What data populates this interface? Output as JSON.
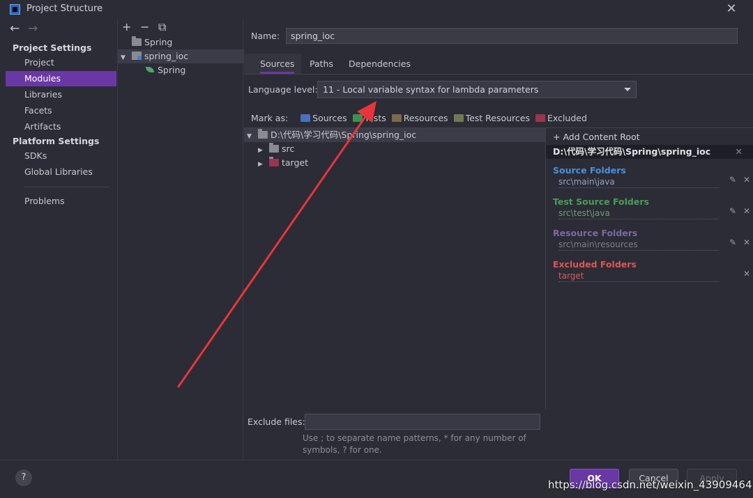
{
  "window": {
    "title": "Project Structure",
    "close_glyph": "✕"
  },
  "nav": {
    "back": "←",
    "forward": "→",
    "project_settings_header": "Project Settings",
    "platform_settings_header": "Platform Settings",
    "project_items": [
      "Project",
      "Modules",
      "Libraries",
      "Facets",
      "Artifacts"
    ],
    "platform_items": [
      "SDKs",
      "Global Libraries"
    ],
    "problems": "Problems",
    "selected": "Modules"
  },
  "module_tree": {
    "tools": [
      "+",
      "−",
      "⧉"
    ],
    "items": [
      {
        "label": "Spring",
        "kind": "folder"
      },
      {
        "label": "spring_ioc",
        "kind": "module",
        "expanded": true
      },
      {
        "label": "Spring",
        "kind": "facet"
      }
    ]
  },
  "module": {
    "name_label": "Name:",
    "name_value": "spring_ioc",
    "tabs": [
      "Sources",
      "Paths",
      "Dependencies"
    ],
    "active_tab": "Sources",
    "language_level_label": "Language level:",
    "language_level_value": "11 - Local variable syntax for lambda parameters",
    "mark_as_label": "Mark as:",
    "mark_as": [
      {
        "label": "Sources",
        "color": "#4a6fbf"
      },
      {
        "label": "Tests",
        "color": "#3f8f55"
      },
      {
        "label": "Resources",
        "color": "#7c6a4a"
      },
      {
        "label": "Test Resources",
        "color": "#6f7a52"
      },
      {
        "label": "Excluded",
        "color": "#9a3550"
      }
    ],
    "content_tree": [
      {
        "label": "D:\\代码\\学习代码\\Spring\\spring_ioc",
        "level": 0,
        "expanded": true
      },
      {
        "label": "src",
        "level": 1,
        "color": "#8a8b92"
      },
      {
        "label": "target",
        "level": 1,
        "color": "#9a3550"
      }
    ],
    "exclude_files_label": "Exclude files:",
    "exclude_files_value": "",
    "exclude_hint": "Use ; to separate name patterns, * for any number of symbols, ? for one."
  },
  "roots": {
    "add_label": "+ Add Content Root",
    "path": "D:\\代码\\学习代码\\Spring\\spring_ioc",
    "groups": [
      {
        "title": "Source Folders",
        "color": "#4b8fe0",
        "path": "src\\main\\java",
        "path_color": "#8fa6c8",
        "editable": true
      },
      {
        "title": "Test Source Folders",
        "color": "#4a9c5a",
        "path": "src\\test\\java",
        "path_color": "#6f9f7a",
        "editable": true
      },
      {
        "title": "Resource Folders",
        "color": "#7b6aa0",
        "path": "src\\main\\resources",
        "path_color": "#7c7f8c",
        "editable": true
      },
      {
        "title": "Excluded Folders",
        "color": "#e05555",
        "path": "target",
        "path_color": "#e05a5a",
        "editable": false
      }
    ]
  },
  "footer": {
    "help": "?",
    "ok": "OK",
    "cancel": "Cancel",
    "apply": "Apply",
    "watermark": "https://blog.csdn.net/weixin_43909464"
  },
  "annotation": {
    "color": "#e8353a"
  }
}
